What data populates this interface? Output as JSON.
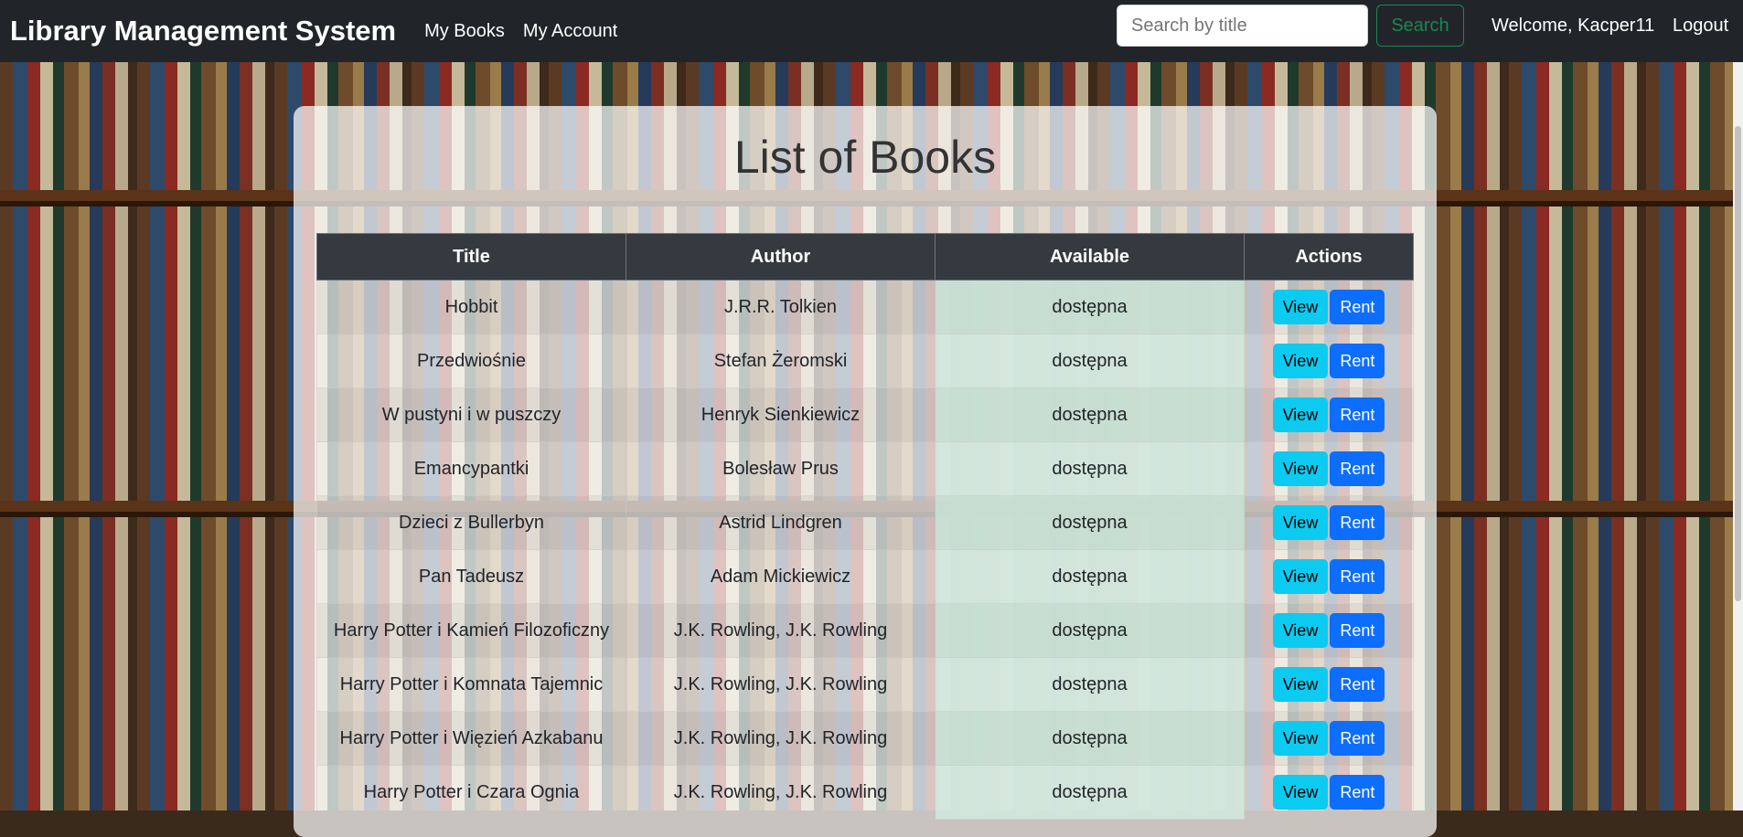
{
  "navbar": {
    "brand": "Library Management System",
    "links": [
      "My Books",
      "My Account"
    ],
    "search_placeholder": "Search by title",
    "search_button": "Search",
    "welcome": "Welcome, Kacper11",
    "logout": "Logout"
  },
  "main": {
    "title": "List of Books",
    "columns": [
      "Title",
      "Author",
      "Available",
      "Actions"
    ],
    "view_label": "View",
    "rent_label": "Rent",
    "rows": [
      {
        "title": "Hobbit",
        "author": "J.R.R. Tolkien",
        "available": "dostępna"
      },
      {
        "title": "Przedwiośnie",
        "author": "Stefan Żeromski",
        "available": "dostępna"
      },
      {
        "title": "W pustyni i w puszczy",
        "author": "Henryk Sienkiewicz",
        "available": "dostępna"
      },
      {
        "title": "Emancypantki",
        "author": "Bolesław Prus",
        "available": "dostępna"
      },
      {
        "title": "Dzieci z Bullerbyn",
        "author": "Astrid Lindgren",
        "available": "dostępna"
      },
      {
        "title": "Pan Tadeusz",
        "author": "Adam Mickiewicz",
        "available": "dostępna"
      },
      {
        "title": "Harry Potter i Kamień Filozoficzny",
        "author": "J.K. Rowling, J.K. Rowling",
        "available": "dostępna"
      },
      {
        "title": "Harry Potter i Komnata Tajemnic",
        "author": "J.K. Rowling, J.K. Rowling",
        "available": "dostępna"
      },
      {
        "title": "Harry Potter i Więzień Azkabanu",
        "author": "J.K. Rowling, J.K. Rowling",
        "available": "dostępna"
      },
      {
        "title": "Harry Potter i Czara Ognia",
        "author": "J.K. Rowling, J.K. Rowling",
        "available": "dostępna"
      }
    ]
  },
  "colors": {
    "navbar": "#212529",
    "view_button": "#0dcaf0",
    "rent_button": "#0d6efd",
    "available_cell": "#d1e7dd",
    "search_button": "#198754"
  }
}
